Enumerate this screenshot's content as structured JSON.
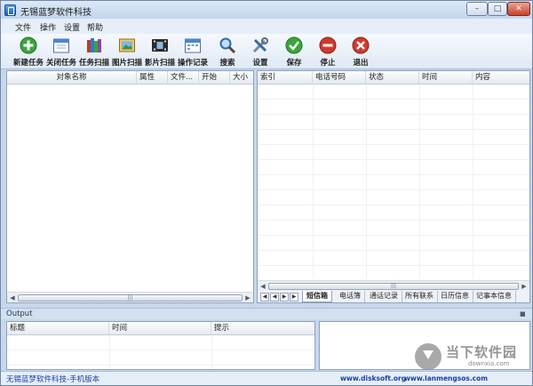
{
  "window": {
    "title": "无锡蓝梦软件科技"
  },
  "menu": {
    "items": [
      "文件",
      "操作",
      "设置",
      "帮助"
    ]
  },
  "toolbar": {
    "items": [
      {
        "label": "新建任务",
        "icon": "add-icon"
      },
      {
        "label": "关闭任务",
        "icon": "calendar-close-icon"
      },
      {
        "label": "任务扫描",
        "icon": "books-icon"
      },
      {
        "label": "图片扫描",
        "icon": "picture-icon"
      },
      {
        "label": "影片扫描",
        "icon": "film-icon"
      },
      {
        "label": "操作记录",
        "icon": "calendar-icon"
      },
      {
        "label": "搜索",
        "icon": "search-icon"
      },
      {
        "label": "设置",
        "icon": "tools-icon"
      },
      {
        "label": "保存",
        "icon": "check-icon"
      },
      {
        "label": "停止",
        "icon": "stop-icon"
      },
      {
        "label": "退出",
        "icon": "exit-icon"
      }
    ]
  },
  "left_grid": {
    "columns": [
      "对象名称",
      "属性",
      "文件...",
      "开始",
      "大小"
    ]
  },
  "right_grid": {
    "columns": [
      "索引",
      "电话号码",
      "状态",
      "时间",
      "内容"
    ]
  },
  "tabs": {
    "items": [
      "短信箱",
      "电话簿",
      "通话记录",
      "所有联系",
      "日历信息",
      "记事本信息"
    ],
    "active": "短信箱"
  },
  "output": {
    "title": "Output",
    "columns": [
      "标题",
      "时间",
      "提示"
    ]
  },
  "status": {
    "left": "无锡蓝梦软件科技-手机版本",
    "link1": "www.disksoft.org",
    "link2": "www.lanmengsos.com"
  },
  "watermark": {
    "title": "当下软件园",
    "sub": "downxia.com"
  },
  "colors": {
    "accent": "#1a3fa8",
    "add": "#3aa53a",
    "save": "#3aa53a",
    "stop": "#d03a2e",
    "exit": "#d03a2e"
  }
}
